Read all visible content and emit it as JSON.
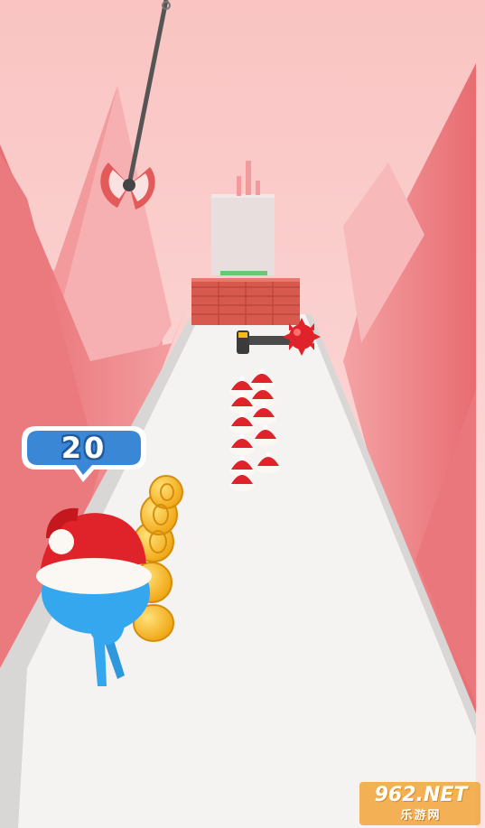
{
  "hud": {
    "crowd_count": "20"
  },
  "watermark": {
    "brand": "962.NET",
    "subtitle": "乐游网"
  },
  "colors": {
    "sky": "#fbd6d4",
    "mountain": "#ee7d80",
    "track": "#f3f2f1",
    "bubble": "#3a87d6",
    "player": "#35a7ee",
    "santa_hat": "#e0232a",
    "coin": "#f5b725"
  }
}
